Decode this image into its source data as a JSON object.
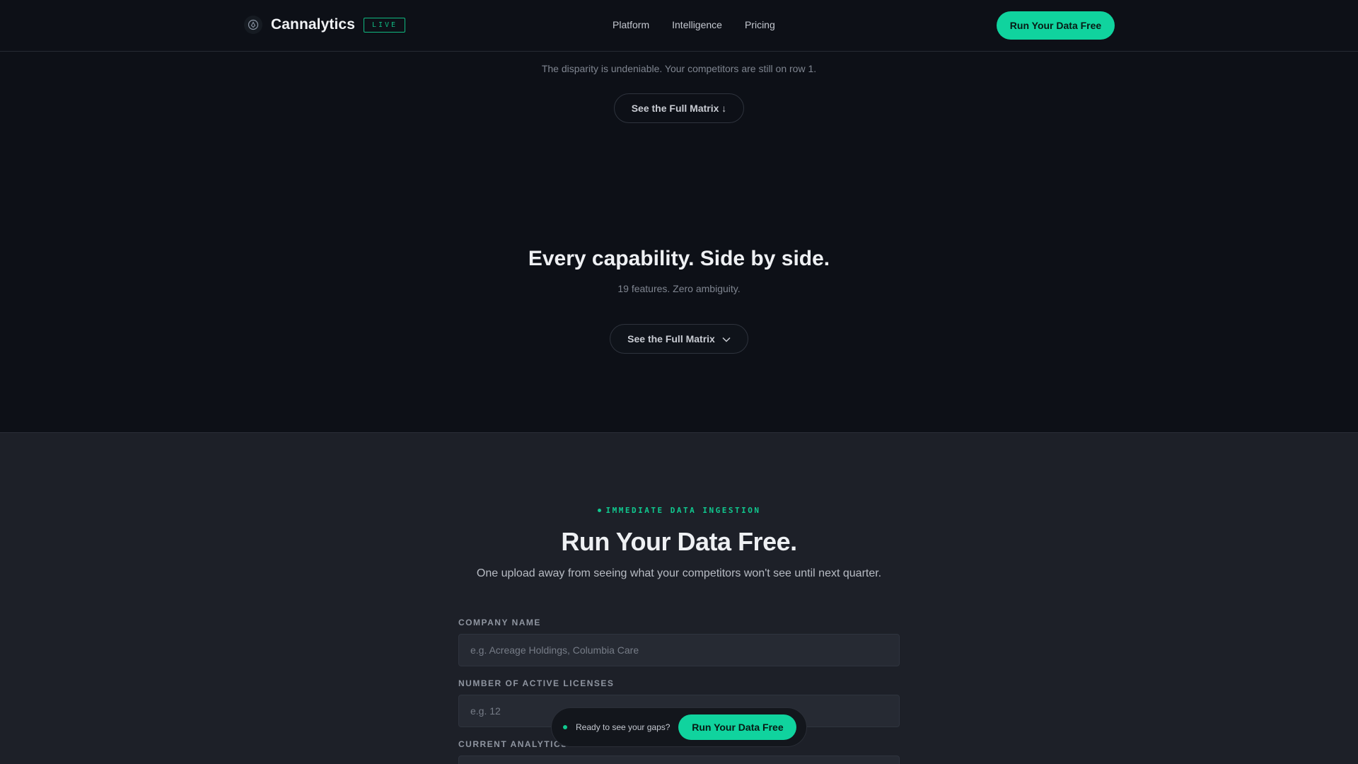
{
  "nav": {
    "brand": "Cannalytics",
    "badge": "LIVE",
    "links": [
      "Platform",
      "Intelligence",
      "Pricing"
    ],
    "cta": "Run Your Data Free"
  },
  "top": {
    "subtitle": "The disparity is undeniable. Your competitors are still on row 1.",
    "button": "See the Full Matrix ↓"
  },
  "matrix": {
    "heading": "Every capability. Side by side.",
    "subheading": "19 features. Zero ambiguity.",
    "button": "See the Full Matrix"
  },
  "cta_section": {
    "eyebrow": "IMMEDIATE DATA INGESTION",
    "title": "Run Your Data Free.",
    "subtitle": "One upload away from seeing what your competitors won't see until next quarter.",
    "fields": [
      {
        "label": "COMPANY NAME",
        "placeholder": "e.g. Acreage Holdings, Columbia Care"
      },
      {
        "label": "NUMBER OF ACTIVE LICENSES",
        "placeholder": "e.g. 12"
      },
      {
        "label": "CURRENT ANALYTICS",
        "placeholder": ""
      }
    ]
  },
  "floating_bar": {
    "text": "Ready to see your gaps?",
    "cta": "Run Your Data Free"
  },
  "colors": {
    "accent": "#10d39e",
    "background": "#0d1017",
    "section_bg": "#1d2028"
  }
}
